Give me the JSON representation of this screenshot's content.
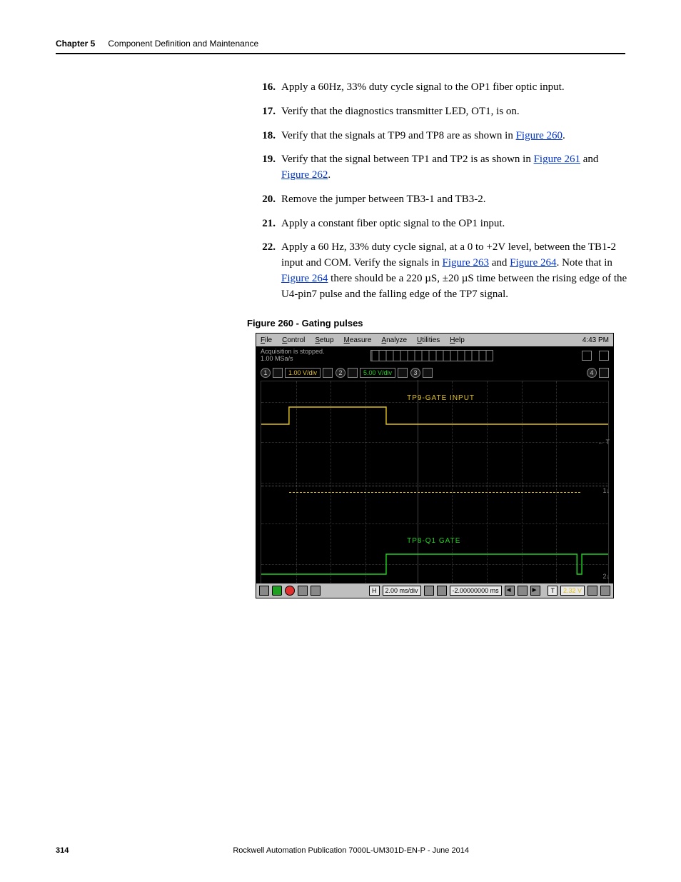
{
  "header": {
    "chapter": "Chapter 5",
    "title": "Component Definition and Maintenance"
  },
  "steps": [
    {
      "n": "16.",
      "text": "Apply a 60Hz, 33% duty cycle signal to the OP1 fiber optic input."
    },
    {
      "n": "17.",
      "text": "Verify that the diagnostics transmitter LED, OT1, is on."
    },
    {
      "n": "18.",
      "pre": "Verify that the signals at TP9 and TP8 are as shown in ",
      "link1": "Figure 260",
      "post1": "."
    },
    {
      "n": "19.",
      "pre": "Verify that the signal between TP1 and TP2 is as shown in ",
      "link1": "Figure 261",
      "mid": " and ",
      "link2": "Figure 262",
      "post2": "."
    },
    {
      "n": "20.",
      "text": "Remove the jumper between TB3-1 and TB3-2."
    },
    {
      "n": "21.",
      "text": "Apply a constant fiber optic signal to the OP1 input."
    },
    {
      "n": "22.",
      "pre": "Apply a 60 Hz, 33% duty cycle signal, at a 0 to +2V level, between the TB1-2 input and COM. Verify the signals in ",
      "link1": "Figure 263",
      "mid": " and ",
      "link2": "Figure 264",
      "post2": ". Note that in ",
      "link3": "Figure 264",
      "post3": " there should be a 220 µS, ±20 µS time between the rising edge of the U4-pin7 pulse and the falling edge of the TP7 signal."
    }
  ],
  "figure_caption": "Figure 260 - Gating pulses",
  "scope": {
    "menu": {
      "file": "File",
      "control": "Control",
      "setup": "Setup",
      "measure": "Measure",
      "analyze": "Analyze",
      "utilities": "Utilities",
      "help": "Help",
      "time": "4:43 PM"
    },
    "status": {
      "line1": "Acquisition is stopped.",
      "line2": "1.00 MSa/s"
    },
    "channels": {
      "ch1": {
        "n": "1",
        "val": "1.00 V/div"
      },
      "ch2": {
        "n": "2",
        "val": "5.00 V/div"
      },
      "ch3": {
        "n": "3"
      },
      "ch4": {
        "n": "4"
      }
    },
    "labels": {
      "tp9": "TP9-GATE INPUT",
      "tp8": "TP8-Q1 GATE"
    },
    "bottom": {
      "h": "H",
      "timediv": "2.00 ms/div",
      "offset": "-2.00000000 ms",
      "trig": "T",
      "trigv": "2.32 V"
    }
  },
  "footer": {
    "page": "314",
    "pub": "Rockwell Automation Publication 7000L-UM301D-EN-P - June 2014"
  }
}
